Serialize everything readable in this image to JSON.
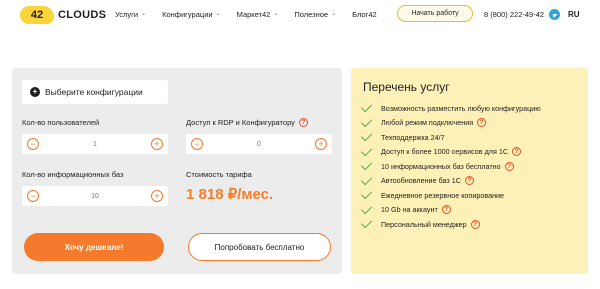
{
  "logo": {
    "badge": "42",
    "text": "CLOUDS"
  },
  "nav": [
    {
      "label": "Услуги"
    },
    {
      "label": "Конфигурации"
    },
    {
      "label": "Маркет42"
    },
    {
      "label": "Полезное"
    },
    {
      "label": "Блог42"
    }
  ],
  "header": {
    "start_button": "Начать работу",
    "phone": "8 (800) 222-49-42",
    "lang": "RU",
    "telegram_icon": "telegram-icon"
  },
  "config": {
    "pick_label": "Выберите конфигурации",
    "users_label": "Кол-во пользователей",
    "users_value": "1",
    "rdp_label": "Доступ к RDP и Конфигуратору",
    "rdp_value": "0",
    "bases_label": "Кол-во информационных баз",
    "bases_value": "10",
    "price_label": "Стоимость тарифа",
    "price_value": "1 818 ₽/мес.",
    "minus": "−",
    "plus": "+",
    "question": "?",
    "cheaper_button": "Хочу дешевле!",
    "free_button": "Попробовать бесплатно"
  },
  "services": {
    "title": "Перечень услуг",
    "items": [
      {
        "label": "Возможность разместить любую конфигурацию",
        "info": false
      },
      {
        "label": "Любой режим подключения",
        "info": true
      },
      {
        "label": "Техподдержка 24/7",
        "info": false
      },
      {
        "label": "Доступ к более 1000 сервисов для 1С",
        "info": true
      },
      {
        "label": "10 информационных баз бесплатно",
        "info": true
      },
      {
        "label": "Автообновление баз 1С",
        "info": true
      },
      {
        "label": "Ежедневное резервное копирование",
        "info": false
      },
      {
        "label": "10 Gb на аккаунт",
        "info": true
      },
      {
        "label": "Персональный менеджер",
        "info": true
      }
    ]
  },
  "colors": {
    "accent": "#f57a2c",
    "yellow_panel": "#fdf1b8",
    "gray_panel": "#ececec",
    "check": "#5aa94a"
  }
}
